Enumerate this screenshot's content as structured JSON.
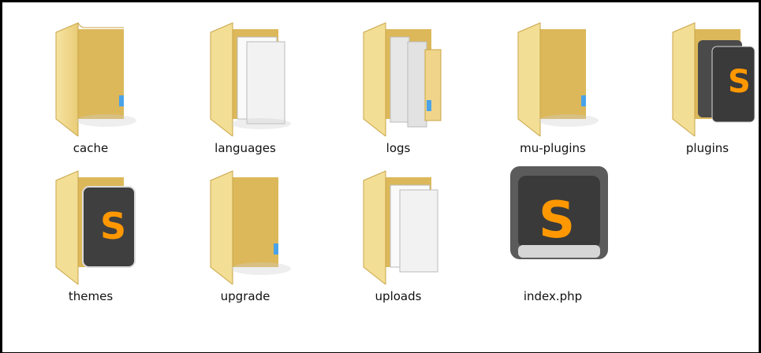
{
  "window": {
    "title": ""
  },
  "items": [
    {
      "name": "cache",
      "type": "folder",
      "icon": "folder-icon"
    },
    {
      "name": "languages",
      "type": "folder",
      "icon": "folder-documents-icon"
    },
    {
      "name": "logs",
      "type": "folder",
      "icon": "folder-files-icon"
    },
    {
      "name": "mu-plugins",
      "type": "folder",
      "icon": "folder-icon"
    },
    {
      "name": "plugins",
      "type": "folder",
      "icon": "folder-sublime-icon"
    },
    {
      "name": "themes",
      "type": "folder",
      "icon": "folder-sublime-icon"
    },
    {
      "name": "upgrade",
      "type": "folder",
      "icon": "folder-icon"
    },
    {
      "name": "uploads",
      "type": "folder",
      "icon": "folder-documents-icon"
    },
    {
      "name": "index.php",
      "type": "file",
      "icon": "sublime-text-file-icon"
    }
  ],
  "colors": {
    "folder_back": "#e7c86a",
    "folder_front": "#f8e6a8",
    "sublime_bg": "#3a3a3a",
    "sublime_accent": "#ff9800"
  }
}
